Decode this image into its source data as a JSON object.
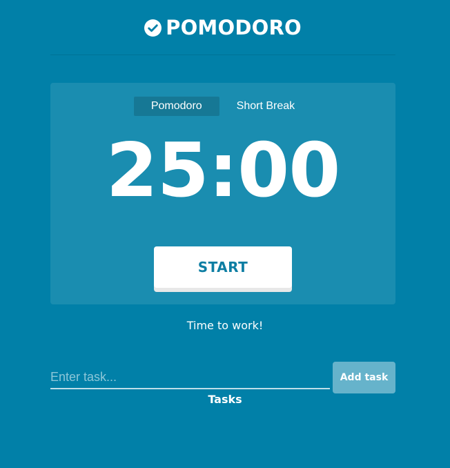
{
  "header": {
    "title": "POMODORO",
    "icon": "check-circle-icon"
  },
  "timer": {
    "modes": [
      {
        "label": "Pomodoro",
        "active": true
      },
      {
        "label": "Short Break",
        "active": false
      }
    ],
    "time": "25:00",
    "start_label": "START"
  },
  "status": {
    "message": "Time to work!"
  },
  "tasks": {
    "input_placeholder": "Enter task...",
    "input_value": "",
    "add_label": "Add task",
    "heading": "Tasks"
  },
  "colors": {
    "background": "#0180a8",
    "accent_text": "#0e7ea3",
    "foreground": "#ffffff"
  }
}
